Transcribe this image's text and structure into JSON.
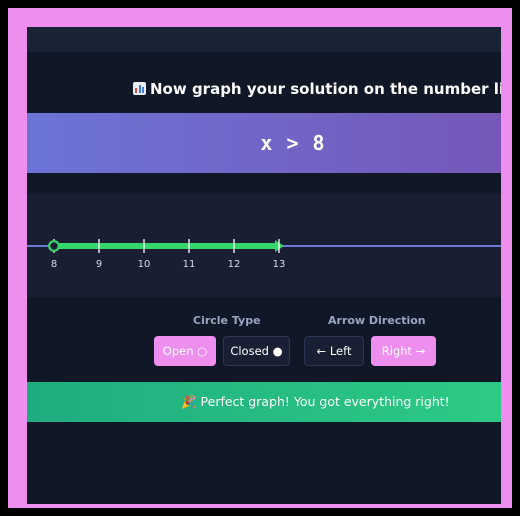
{
  "instruction": {
    "icon": "bar-chart-icon",
    "text": "Now graph your solution on the number line!"
  },
  "inequality": {
    "variable": "x",
    "operator": ">",
    "value": "8",
    "display": "x > 8"
  },
  "number_line": {
    "ticks": [
      "8",
      "9",
      "10",
      "11",
      "12",
      "13"
    ],
    "point": 8,
    "circle": "open",
    "direction": "right",
    "shaded_to": 13,
    "line_color": "#6b79d6",
    "shade_color": "#34d86a"
  },
  "controls": {
    "circle_type": {
      "label": "Circle Type",
      "options": [
        "Open ○",
        "Closed ●"
      ],
      "selected": "Open ○"
    },
    "arrow_direction": {
      "label": "Arrow Direction",
      "options": [
        "← Left",
        "Right →"
      ],
      "selected": "Right →"
    }
  },
  "feedback": {
    "icon": "party-popper-icon",
    "text": "🎉 Perfect graph! You got everything right!",
    "color": "#2ccb84"
  },
  "colors": {
    "accent": "#ee8ff0",
    "background": "#101727",
    "banner_start": "#6b75d6",
    "banner_end": "#7657b8"
  }
}
